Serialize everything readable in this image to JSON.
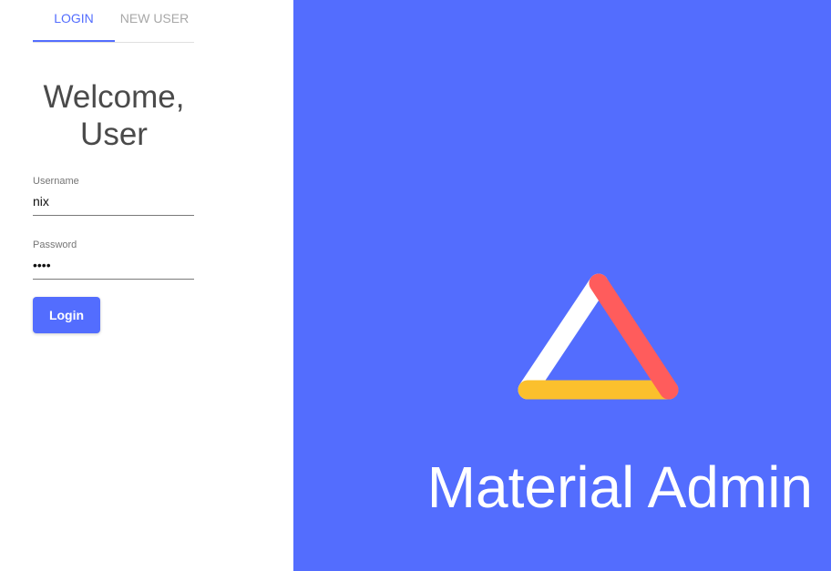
{
  "tabs": [
    {
      "label": "LOGIN",
      "active": true
    },
    {
      "label": "NEW USER",
      "active": false
    }
  ],
  "greeting": {
    "line1": "Welcome,",
    "line2": "User"
  },
  "form": {
    "username": {
      "label": "Username",
      "value": "nix"
    },
    "password": {
      "label": "Password",
      "value": "nixx"
    },
    "login_button": "Login"
  },
  "brand": {
    "title": "Material Admin",
    "logo_icon": "triangle-logo-icon"
  },
  "colors": {
    "primary": "#536dfe",
    "logo_red": "#ff5c5c",
    "logo_yellow": "#fbc02d",
    "logo_white": "#ffffff",
    "heading": "#4a4a4a",
    "inactive_tab": "#a8a8a8"
  }
}
